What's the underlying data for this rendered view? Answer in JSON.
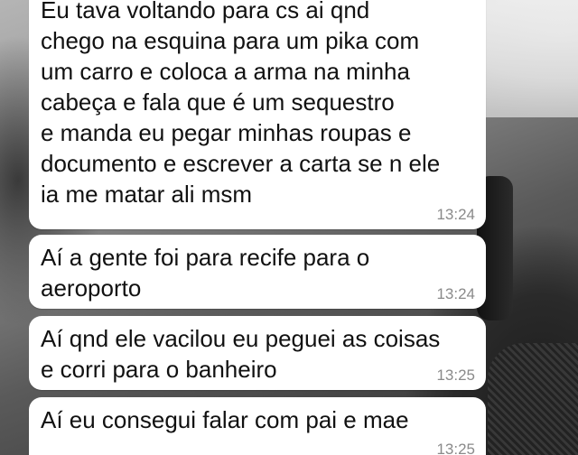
{
  "messages": [
    {
      "text": "Eu tava voltando para cs ai qnd\nchego na esquina para um pika com\num carro e coloca a arma na minha\ncabeça e fala que é um sequestro\ne manda eu pegar minhas roupas e\ndocumento e escrever a carta se n ele\nia me matar ali msm",
      "time": "13:24"
    },
    {
      "text": "Aí a gente foi para recife para o\naeroporto",
      "time": "13:24"
    },
    {
      "text": "Aí qnd ele vacilou eu peguei as coisas\ne corri para o banheiro",
      "time": "13:25"
    },
    {
      "text": "Aí eu consegui falar com pai e mae",
      "time": "13:25"
    }
  ],
  "colors": {
    "bubble": "#ffffff",
    "text": "#111111",
    "timestamp": "#8a8a8a"
  }
}
